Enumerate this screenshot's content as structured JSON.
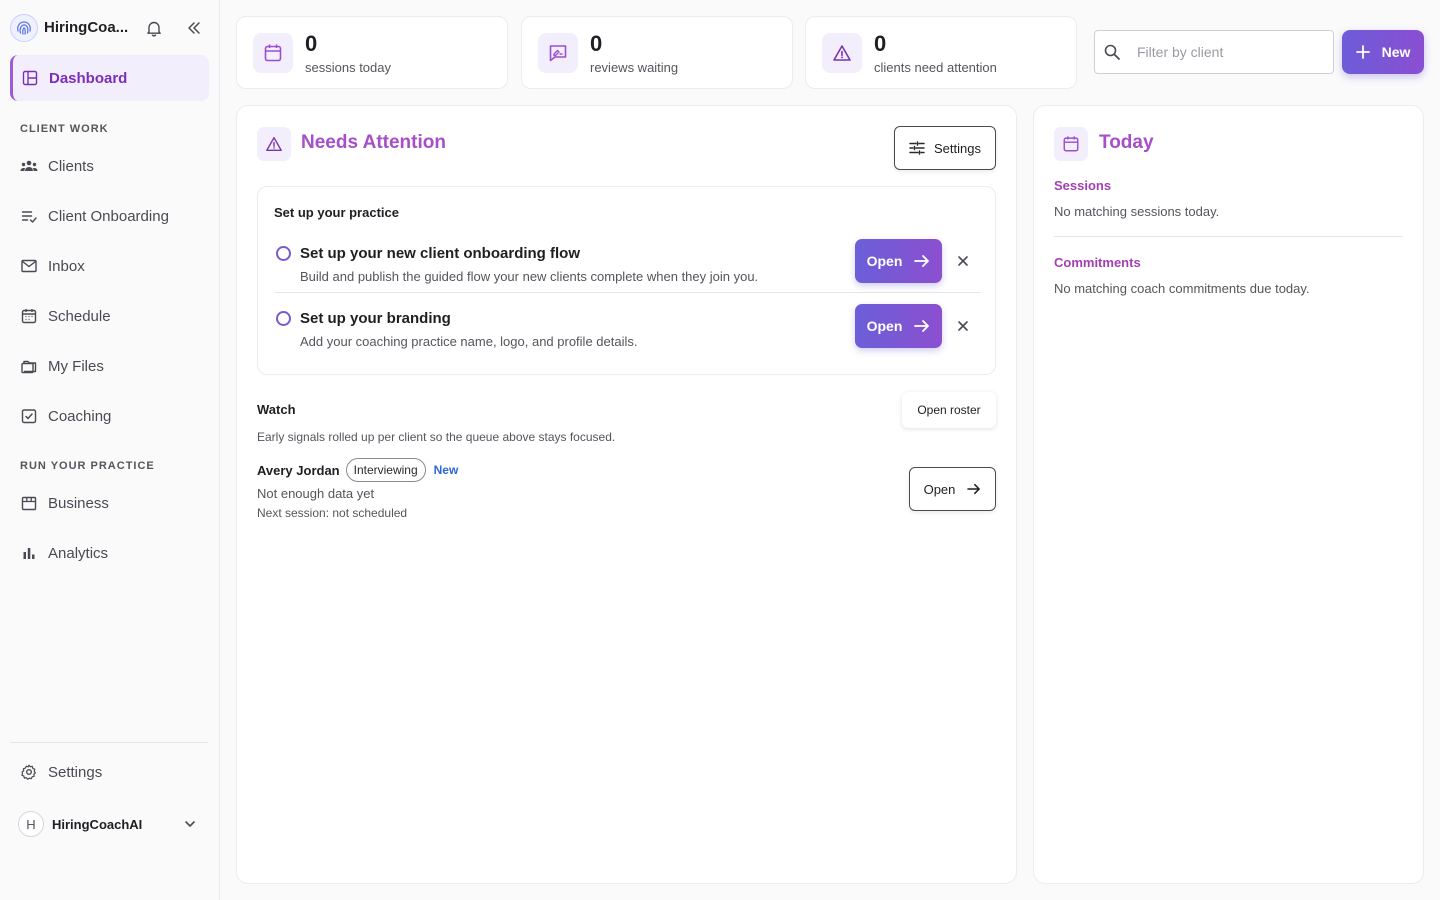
{
  "brand": {
    "name": "HiringCoa..."
  },
  "colors": {
    "accent": "#8a4fd2",
    "accent_text": "#a64fc8",
    "link_blue": "#2f67d8"
  },
  "sidebar": {
    "active": {
      "label": "Dashboard",
      "icon": "dashboard-icon"
    },
    "sections": [
      {
        "label": "CLIENT WORK"
      },
      {
        "label": "RUN YOUR PRACTICE"
      }
    ],
    "items": [
      {
        "label": "Clients",
        "icon": "users-icon"
      },
      {
        "label": "Client Onboarding",
        "icon": "checklist-icon"
      },
      {
        "label": "Inbox",
        "icon": "mail-icon"
      },
      {
        "label": "Schedule",
        "icon": "calendar-icon"
      },
      {
        "label": "My Files",
        "icon": "folder-icon"
      },
      {
        "label": "Coaching",
        "icon": "check-square-icon"
      },
      {
        "label": "Business",
        "icon": "store-icon"
      },
      {
        "label": "Analytics",
        "icon": "bar-chart-icon"
      }
    ],
    "settings_label": "Settings",
    "user": {
      "initial": "H",
      "name": "HiringCoachAI"
    }
  },
  "stats": [
    {
      "value": "0",
      "label": "sessions today",
      "icon": "calendar-icon"
    },
    {
      "value": "0",
      "label": "reviews waiting",
      "icon": "review-icon"
    },
    {
      "value": "0",
      "label": "clients need attention",
      "icon": "warning-icon"
    }
  ],
  "filter": {
    "placeholder": "Filter by client"
  },
  "new_button": "New",
  "needs_attention": {
    "title": "Needs Attention",
    "settings_label": "Settings",
    "setup": {
      "title": "Set up your practice",
      "tasks": [
        {
          "title": "Set up your new client onboarding flow",
          "desc": "Build and publish the guided flow your new clients complete when they join you.",
          "action": "Open"
        },
        {
          "title": "Set up your branding",
          "desc": "Add your coaching practice name, logo, and profile details.",
          "action": "Open"
        }
      ]
    },
    "watch": {
      "title": "Watch",
      "roster_label": "Open roster",
      "desc": "Early signals rolled up per client so the queue above stays focused.",
      "clients": [
        {
          "name": "Avery Jordan",
          "stage": "Interviewing",
          "tag": "New",
          "line1": "Not enough data yet",
          "line2": "Next session: not scheduled",
          "action": "Open"
        }
      ]
    }
  },
  "today": {
    "title": "Today",
    "sessions_label": "Sessions",
    "sessions_empty": "No matching sessions today.",
    "commitments_label": "Commitments",
    "commitments_empty": "No matching coach commitments due today."
  }
}
